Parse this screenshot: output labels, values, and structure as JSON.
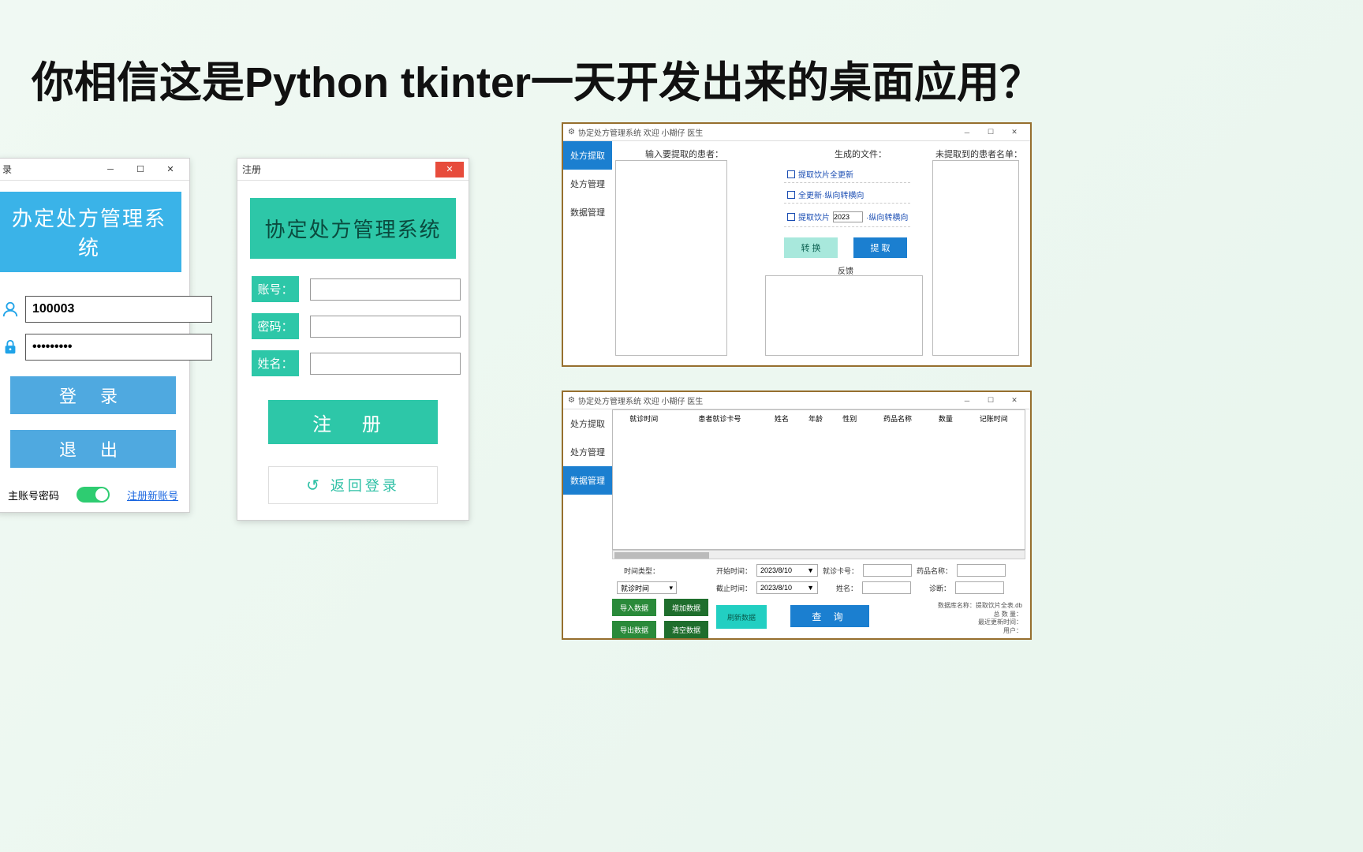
{
  "headline": "你相信这是Python    tkinter一天开发出来的桌面应用？",
  "login": {
    "title": "录",
    "banner": "办定处方管理系统",
    "username": "100003",
    "password": "●●●●●●●●●",
    "login_btn": "登 录",
    "exit_btn": "退 出",
    "remember": "主账号密码",
    "register_link": "注册新账号"
  },
  "register": {
    "title": "注册",
    "banner": "协定处方管理系统",
    "account_lbl": "账号：",
    "password_lbl": "密码：",
    "name_lbl": "姓名：",
    "register_btn": "注 册",
    "back_btn": "返回登录"
  },
  "extract": {
    "title": "协定处方管理系统  欢迎 小糊仔 医生",
    "tabs": [
      "处方提取",
      "处方管理",
      "数据管理"
    ],
    "active_tab": 0,
    "input_patients_lbl": "输入要提取的患者：",
    "generated_files_lbl": "生成的文件：",
    "unextracted_lbl": "未提取到的患者名单：",
    "chk1": "提取饮片全更新",
    "chk2": "全更新·纵向转横向",
    "chk3_pre": "提取饮片",
    "chk3_year": "2023",
    "chk3_post": "·纵向转横向",
    "convert_btn": "转 换",
    "extract_btn": "提 取",
    "feedback_lbl": "反馈"
  },
  "data": {
    "title": "协定处方管理系统  欢迎 小糊仔 医生",
    "tabs": [
      "处方提取",
      "处方管理",
      "数据管理"
    ],
    "active_tab": 2,
    "columns": [
      "就诊时间",
      "患者就诊卡号",
      "姓名",
      "年龄",
      "性别",
      "药品名称",
      "数量",
      "记账时间"
    ],
    "time_type_lbl": "时间类型：",
    "time_type_val": "就诊时间",
    "start_lbl": "开始时间：",
    "end_lbl": "截止时间：",
    "date_val": "2023/8/10",
    "card_lbl": "就诊卡号：",
    "name_lbl": "姓名：",
    "drug_lbl": "药品名称：",
    "diag_lbl": "诊断：",
    "import_btn": "导入数据",
    "add_btn": "增加数据",
    "export_btn": "导出数据",
    "clear_btn": "清空数据",
    "refresh_btn": "刷新数据",
    "query_btn": "查 询",
    "meta_db_lbl": "数据库名称：",
    "meta_db_val": "提取饮片全表.db",
    "meta_total_lbl": "总 数 量：",
    "meta_update_lbl": "最近更新时间：",
    "meta_user_lbl": "用户："
  }
}
